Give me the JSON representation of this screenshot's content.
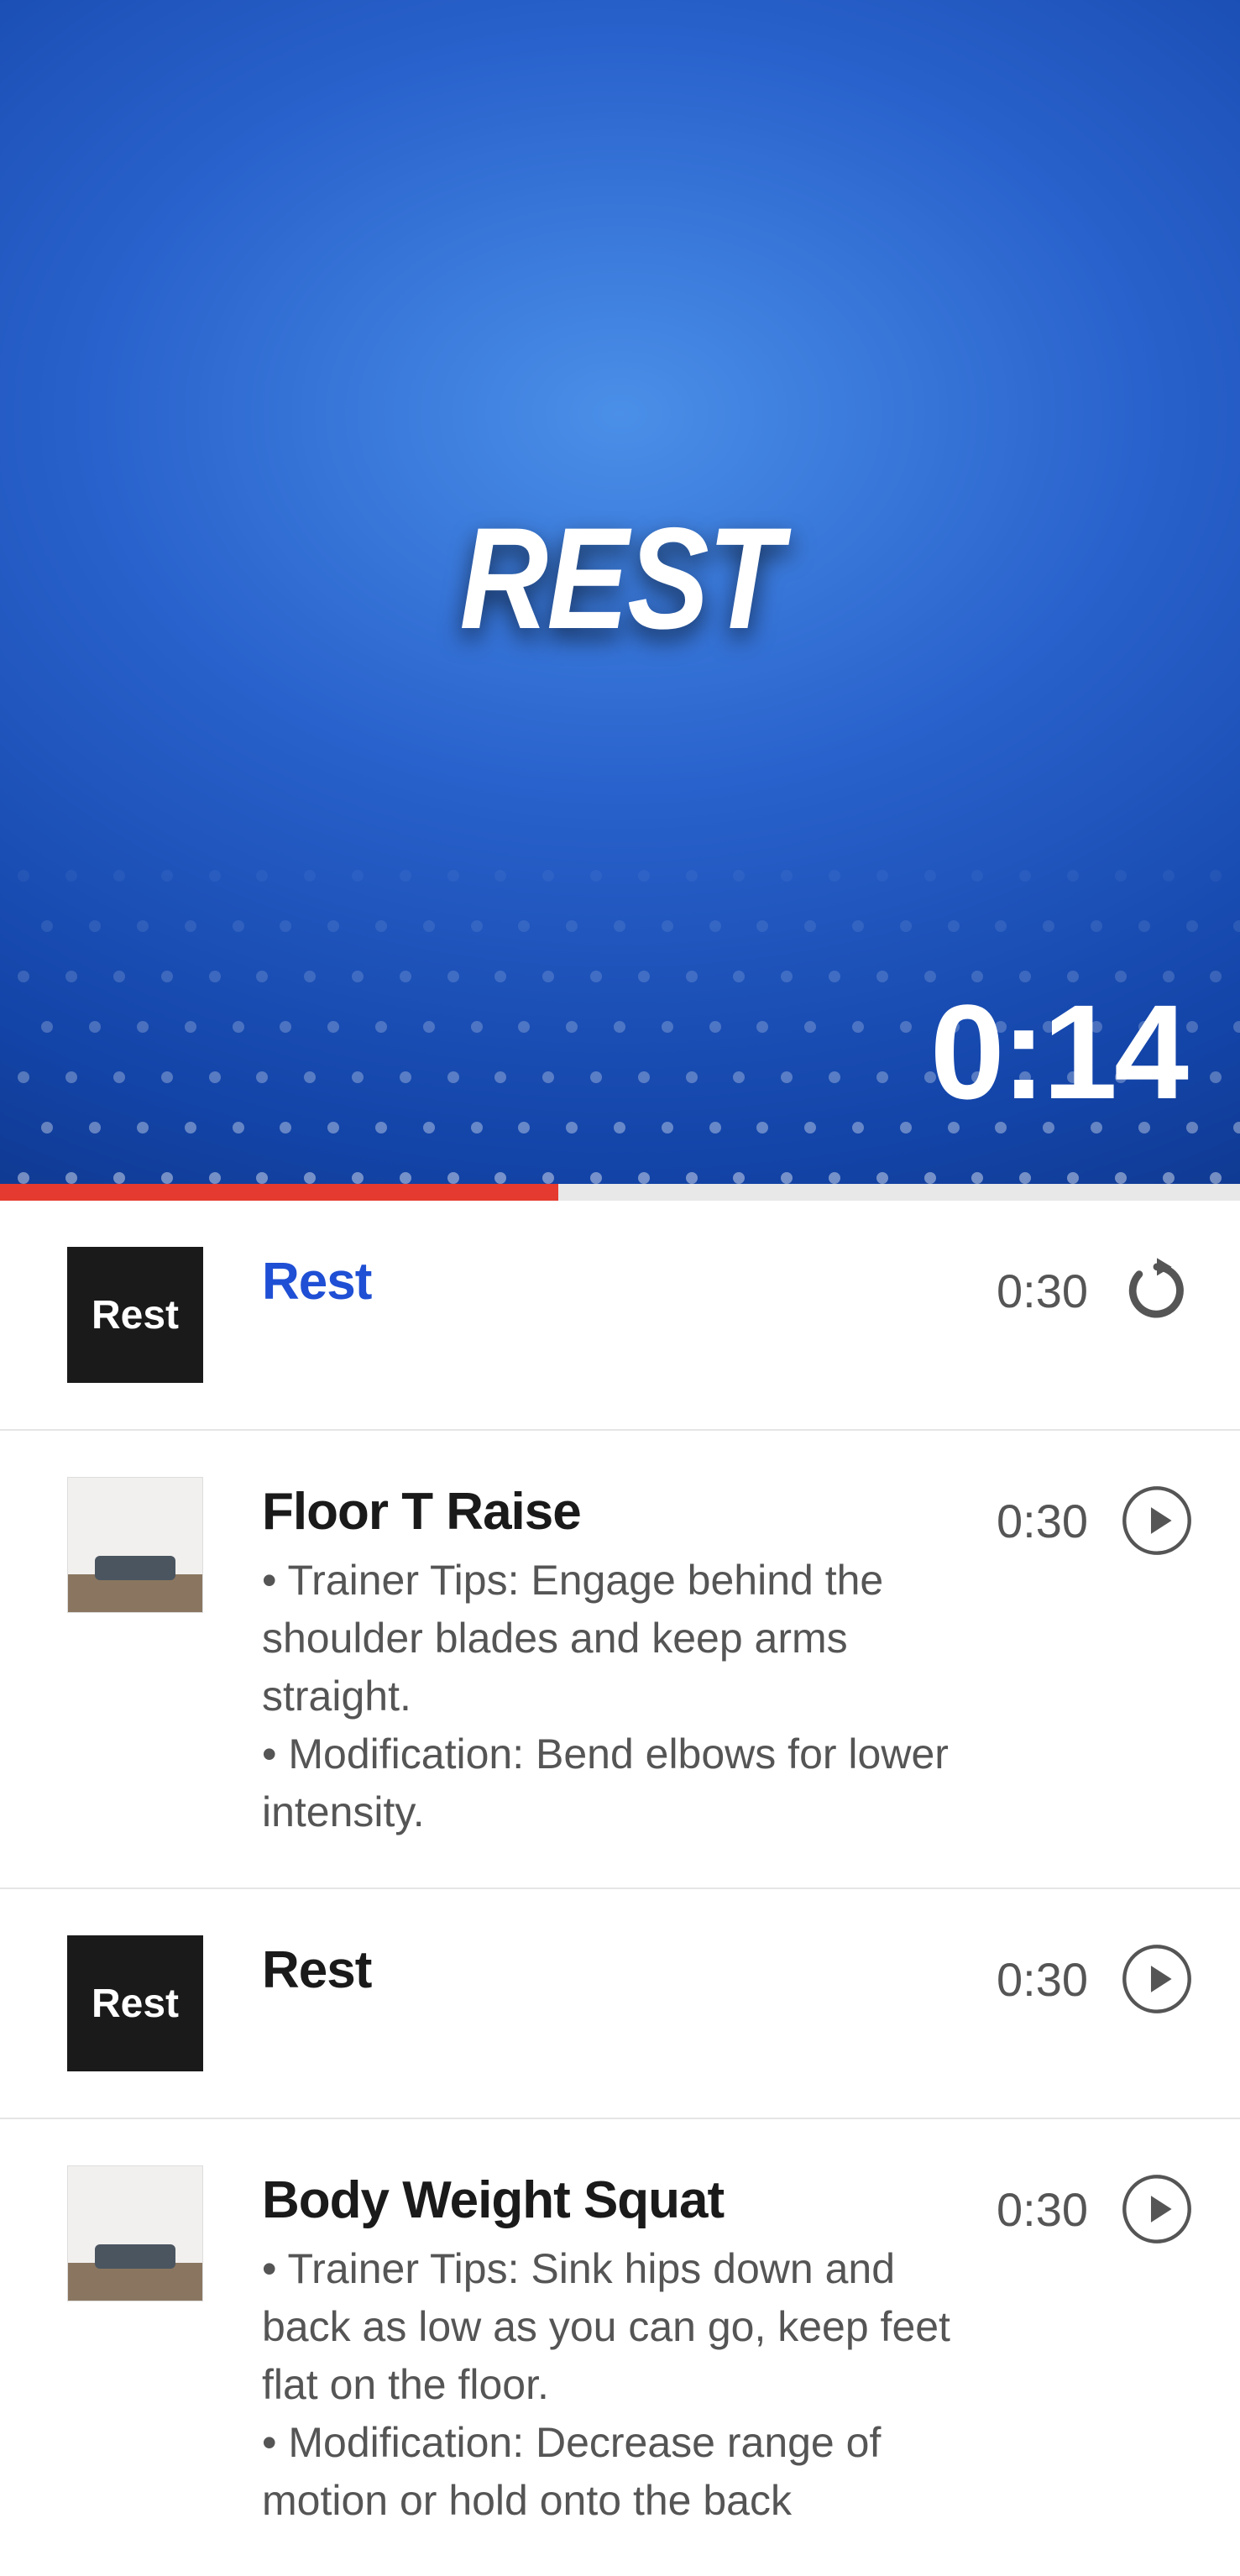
{
  "hero": {
    "title": "REST",
    "timer": "0:14"
  },
  "progress": {
    "percent": 45
  },
  "thumb_labels": {
    "rest": "Rest"
  },
  "items": [
    {
      "title": "Rest",
      "desc": "",
      "time": "0:30",
      "active": true,
      "icon": "refresh",
      "thumb": "rest"
    },
    {
      "title": "Floor T Raise",
      "desc": "• Trainer Tips: Engage behind the shoulder blades and keep arms straight.\n• Modification: Bend elbows for lower intensity.",
      "time": "0:30",
      "active": false,
      "icon": "play",
      "thumb": "img"
    },
    {
      "title": "Rest",
      "desc": "",
      "time": "0:30",
      "active": false,
      "icon": "play",
      "thumb": "rest"
    },
    {
      "title": "Body Weight Squat",
      "desc": "• Trainer Tips: Sink hips down and back as low as you can go, keep feet flat on the floor.\n• Modification: Decrease range of motion or hold onto the back",
      "time": "0:30",
      "active": false,
      "icon": "play",
      "thumb": "img"
    }
  ]
}
